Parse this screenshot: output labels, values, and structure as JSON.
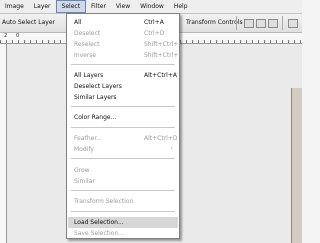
{
  "menubar": {
    "items": [
      "Image",
      "Layer",
      "Select",
      "Filter",
      "View",
      "Window",
      "Help"
    ]
  },
  "options": {
    "auto_select": "Auto Select Layer",
    "transform_controls": "Transform Controls"
  },
  "ruler": {
    "numbers": [
      "2",
      "0"
    ]
  },
  "select_menu": {
    "all": {
      "label": "All",
      "shortcut": "Ctrl+A"
    },
    "deselect": {
      "label": "Deselect",
      "shortcut": "Ctrl+D"
    },
    "reselect": {
      "label": "Reselect",
      "shortcut": "Shift+Ctrl+D"
    },
    "inverse": {
      "label": "Inverse",
      "shortcut": "Shift+Ctrl+I"
    },
    "all_layers": {
      "label": "All Layers",
      "shortcut": "Alt+Ctrl+A"
    },
    "deselect_layers": {
      "label": "Deselect Layers"
    },
    "similar_layers": {
      "label": "Similar Layers"
    },
    "color_range": {
      "label": "Color Range..."
    },
    "feather": {
      "label": "Feather...",
      "shortcut": "Alt+Ctrl+D"
    },
    "modify": {
      "label": "Modify",
      "arrow": "›"
    },
    "grow": {
      "label": "Grow"
    },
    "similar": {
      "label": "Similar"
    },
    "transform_selection": {
      "label": "Transform Selection"
    },
    "load_selection": {
      "label": "Load Selection..."
    },
    "save_selection": {
      "label": "Save Selection..."
    }
  }
}
